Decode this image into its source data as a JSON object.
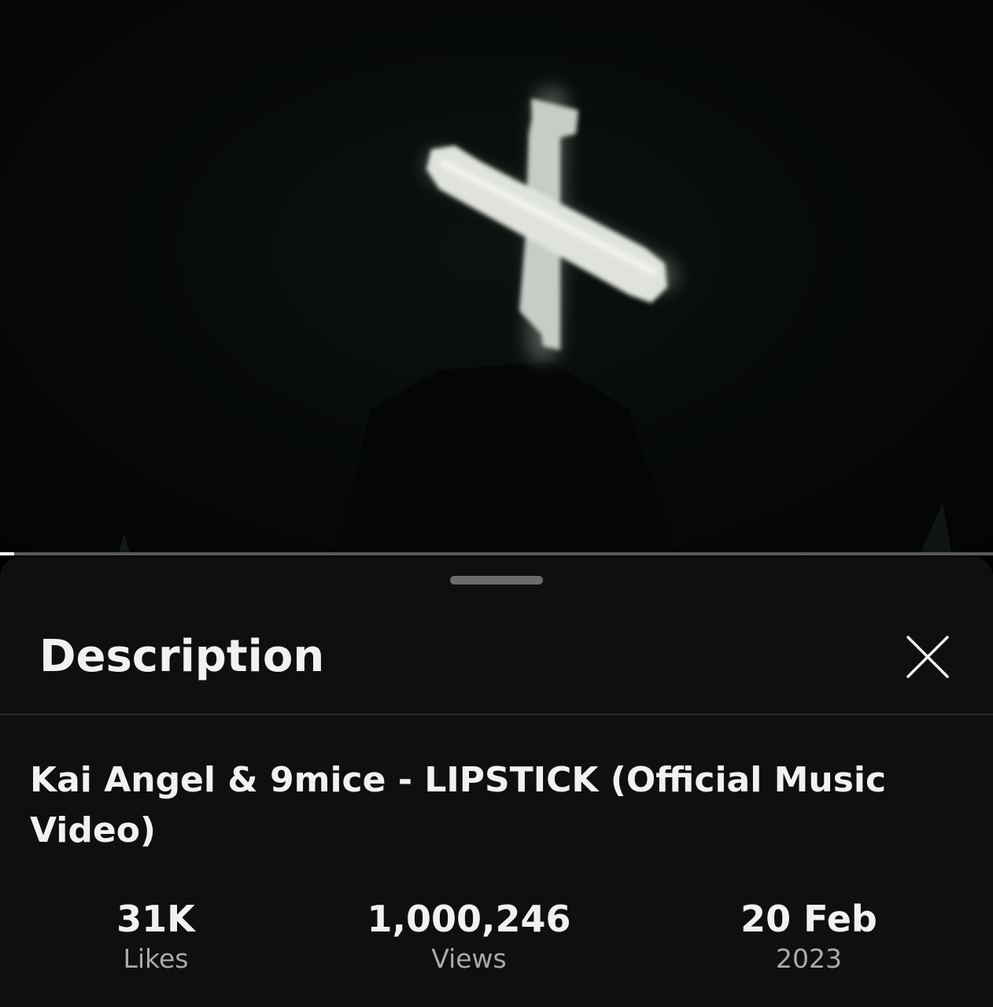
{
  "player": {
    "thumbnail": "cross-silhouette-night",
    "progress_fraction": 0.014
  },
  "description_panel": {
    "title": "Description",
    "close_icon": "close-icon",
    "video_title": "Kai Angel & 9mice - LIPSTICK (Official Music Video)",
    "stats": {
      "likes_value": "31K",
      "likes_label": "Likes",
      "views_value": "1,000,246",
      "views_label": "Views",
      "date_value": "20 Feb",
      "date_label": "2023"
    }
  },
  "colors": {
    "panel_bg": "#0f0f0f",
    "text_primary": "#f1f1f1",
    "text_secondary": "#aaaaaa"
  }
}
